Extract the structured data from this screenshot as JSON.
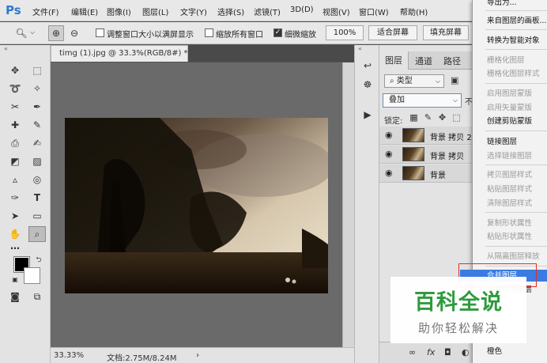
{
  "app": {
    "logo": "Ps"
  },
  "menu": [
    "文件(F)",
    "编辑(E)",
    "图像(I)",
    "图层(L)",
    "文字(Y)",
    "选择(S)",
    "滤镜(T)",
    "3D(D)",
    "视图(V)",
    "窗口(W)",
    "帮助(H)"
  ],
  "options": {
    "resize_windows": {
      "label": "调整窗口大小以满屏显示",
      "checked": false
    },
    "zoom_all": {
      "label": "缩放所有窗口",
      "checked": false
    },
    "scrubby": {
      "label": "细微缩放",
      "checked": true
    },
    "btn_100": "100%",
    "btn_fit": "适合屏幕",
    "btn_fill": "填充屏幕"
  },
  "document": {
    "tab_title": "timg (1).jpg @ 33.3%(RGB/8#) *",
    "zoom": "33.33%",
    "doc_size": "文档:2.75M/8.24M"
  },
  "layers_panel": {
    "tabs": [
      "图层",
      "通道",
      "路径"
    ],
    "filter_label": "类型",
    "blend_mode": "叠加",
    "opacity_hint": "不",
    "lock_label": "锁定:",
    "layers": [
      {
        "name": "背景 拷贝 2"
      },
      {
        "name": "背景 拷贝"
      },
      {
        "name": "背景"
      }
    ]
  },
  "context_menu": {
    "items": [
      {
        "label": "导出为...",
        "disabled": false
      },
      {
        "label": "来自图层的画板...",
        "disabled": false
      },
      {
        "label": "转换为智能对象",
        "disabled": false
      },
      {
        "label": "栅格化图层",
        "disabled": true
      },
      {
        "label": "栅格化图层样式",
        "disabled": true
      },
      {
        "label": "启用图层蒙版",
        "disabled": true
      },
      {
        "label": "启用矢量蒙版",
        "disabled": true
      },
      {
        "label": "创建剪贴蒙版",
        "disabled": false
      },
      {
        "label": "链接图层",
        "disabled": false
      },
      {
        "label": "选择链接图层",
        "disabled": true
      },
      {
        "label": "拷贝图层样式",
        "disabled": true
      },
      {
        "label": "粘贴图层样式",
        "disabled": true
      },
      {
        "label": "清除图层样式",
        "disabled": true
      },
      {
        "label": "复制形状属性",
        "disabled": true
      },
      {
        "label": "粘贴形状属性",
        "disabled": true
      },
      {
        "label": "从隔离图层释放",
        "disabled": true
      },
      {
        "label": "合并图层",
        "highlighted": true
      },
      {
        "label": "合并可见图层",
        "disabled": false
      },
      {
        "label": "橙色",
        "disabled": false
      }
    ]
  },
  "watermark": {
    "title": "百科全说",
    "subtitle": "助你轻松解决"
  },
  "colors": {
    "accent": "#3b7be2",
    "ps_blue": "#2d7ad1",
    "watermark_green": "#2e9b3e",
    "annotation_red": "#e0302a"
  }
}
